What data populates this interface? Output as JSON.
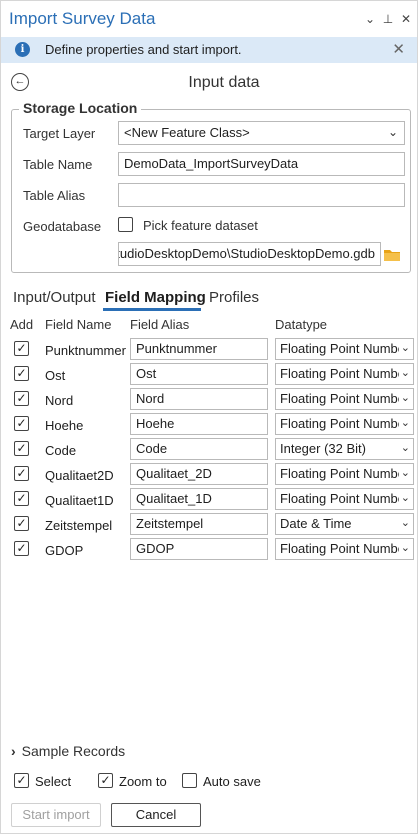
{
  "pane": {
    "title": "Import Survey Data",
    "controls": {
      "menu": "⌄",
      "pin": "⊥",
      "close": "✕"
    }
  },
  "info": {
    "icon": "info-icon",
    "text": "Define properties and start import.",
    "close": "✕"
  },
  "header": {
    "back_icon": "arrow-left-circle-icon",
    "title": "Input data"
  },
  "storage": {
    "legend": "Storage Location",
    "target_layer": {
      "label": "Target Layer",
      "value": "<New Feature Class>"
    },
    "table_name": {
      "label": "Table Name",
      "value": "DemoData_ImportSurveyData"
    },
    "table_alias": {
      "label": "Table Alias",
      "value": ""
    },
    "geodatabase": {
      "label": "Geodatabase",
      "pick_label": "Pick feature dataset",
      "pick_checked": false,
      "path": "\\StudioDesktopDemo\\StudioDesktopDemo.gdb"
    }
  },
  "tabs": [
    {
      "label": "Input/Output",
      "active": false
    },
    {
      "label": "Field Mapping",
      "active": true
    },
    {
      "label": "Profiles",
      "active": false
    }
  ],
  "table": {
    "headers": {
      "add": "Add",
      "name": "Field Name",
      "alias": "Field Alias",
      "type": "Datatype"
    },
    "rows": [
      {
        "checked": true,
        "name": "Punktnummer",
        "alias": "Punktnummer",
        "type": "Floating Point Number"
      },
      {
        "checked": true,
        "name": "Ost",
        "alias": "Ost",
        "type": "Floating Point Number"
      },
      {
        "checked": true,
        "name": "Nord",
        "alias": "Nord",
        "type": "Floating Point Number"
      },
      {
        "checked": true,
        "name": "Hoehe",
        "alias": "Hoehe",
        "type": "Floating Point Number"
      },
      {
        "checked": true,
        "name": "Code",
        "alias": "Code",
        "type": "Integer (32 Bit)"
      },
      {
        "checked": true,
        "name": "Qualitaet2D",
        "alias": "Qualitaet_2D",
        "type": "Floating Point Number"
      },
      {
        "checked": true,
        "name": "Qualitaet1D",
        "alias": "Qualitaet_1D",
        "type": "Floating Point Number"
      },
      {
        "checked": true,
        "name": "Zeitstempel",
        "alias": "Zeitstempel",
        "type": "Date & Time"
      },
      {
        "checked": true,
        "name": "GDOP",
        "alias": "GDOP",
        "type": "Floating Point Number"
      }
    ]
  },
  "sample_records": {
    "label": "Sample Records",
    "expander": "›"
  },
  "options": {
    "select": {
      "label": "Select",
      "checked": true
    },
    "zoom_to": {
      "label": "Zoom to",
      "checked": true
    },
    "auto_save": {
      "label": "Auto save",
      "checked": false
    }
  },
  "buttons": {
    "start_import": "Start import",
    "cancel": "Cancel"
  },
  "check_mark": "✓",
  "dropdown_arrow": "⌄",
  "colors": {
    "accent": "#2b6fb6",
    "info_bg": "#dbe9f7",
    "folder": "#e8a317"
  }
}
